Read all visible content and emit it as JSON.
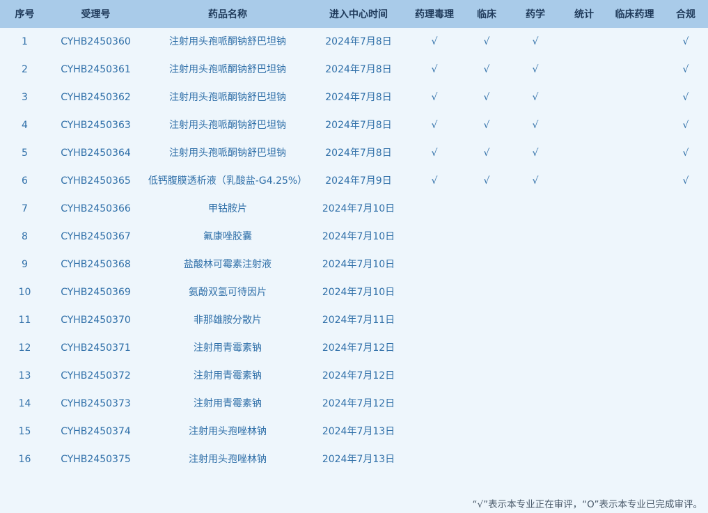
{
  "table": {
    "headers": [
      "序号",
      "受理号",
      "药品名称",
      "进入中心时间",
      "药理毒理",
      "临床",
      "药学",
      "统计",
      "临床药理",
      "合规"
    ],
    "rows": [
      [
        "1",
        "CYHB2450360",
        "注射用头孢哌酮钠舒巴坦钠",
        "2024年7月8日",
        "√",
        "√",
        "√",
        "",
        "",
        "√"
      ],
      [
        "2",
        "CYHB2450361",
        "注射用头孢哌酮钠舒巴坦钠",
        "2024年7月8日",
        "√",
        "√",
        "√",
        "",
        "",
        "√"
      ],
      [
        "3",
        "CYHB2450362",
        "注射用头孢哌酮钠舒巴坦钠",
        "2024年7月8日",
        "√",
        "√",
        "√",
        "",
        "",
        "√"
      ],
      [
        "4",
        "CYHB2450363",
        "注射用头孢哌酮钠舒巴坦钠",
        "2024年7月8日",
        "√",
        "√",
        "√",
        "",
        "",
        "√"
      ],
      [
        "5",
        "CYHB2450364",
        "注射用头孢哌酮钠舒巴坦钠",
        "2024年7月8日",
        "√",
        "√",
        "√",
        "",
        "",
        "√"
      ],
      [
        "6",
        "CYHB2450365",
        "低钙腹膜透析液（乳酸盐-G4.25%）",
        "2024年7月9日",
        "√",
        "√",
        "√",
        "",
        "",
        "√"
      ],
      [
        "7",
        "CYHB2450366",
        "甲钴胺片",
        "2024年7月10日",
        "",
        "",
        "",
        "",
        "",
        ""
      ],
      [
        "8",
        "CYHB2450367",
        "氟康唑胶囊",
        "2024年7月10日",
        "",
        "",
        "",
        "",
        "",
        ""
      ],
      [
        "9",
        "CYHB2450368",
        "盐酸林可霉素注射液",
        "2024年7月10日",
        "",
        "",
        "",
        "",
        "",
        ""
      ],
      [
        "10",
        "CYHB2450369",
        "氨酚双氢可待因片",
        "2024年7月10日",
        "",
        "",
        "",
        "",
        "",
        ""
      ],
      [
        "11",
        "CYHB2450370",
        "非那雄胺分散片",
        "2024年7月11日",
        "",
        "",
        "",
        "",
        "",
        ""
      ],
      [
        "12",
        "CYHB2450371",
        "注射用青霉素钠",
        "2024年7月12日",
        "",
        "",
        "",
        "",
        "",
        ""
      ],
      [
        "13",
        "CYHB2450372",
        "注射用青霉素钠",
        "2024年7月12日",
        "",
        "",
        "",
        "",
        "",
        ""
      ],
      [
        "14",
        "CYHB2450373",
        "注射用青霉素钠",
        "2024年7月12日",
        "",
        "",
        "",
        "",
        "",
        ""
      ],
      [
        "15",
        "CYHB2450374",
        "注射用头孢唑林钠",
        "2024年7月13日",
        "",
        "",
        "",
        "",
        "",
        ""
      ],
      [
        "16",
        "CYHB2450375",
        "注射用头孢唑林钠",
        "2024年7月13日",
        "",
        "",
        "",
        "",
        "",
        ""
      ]
    ]
  },
  "footnote": "“√”表示本专业正在审评，“O”表示本专业已完成审评。",
  "colors": {
    "header_bg": "#a9cbe9",
    "header_text": "#1f3a5a",
    "cell_text": "#2f6fa8",
    "page_bg": "#eef6fc"
  }
}
